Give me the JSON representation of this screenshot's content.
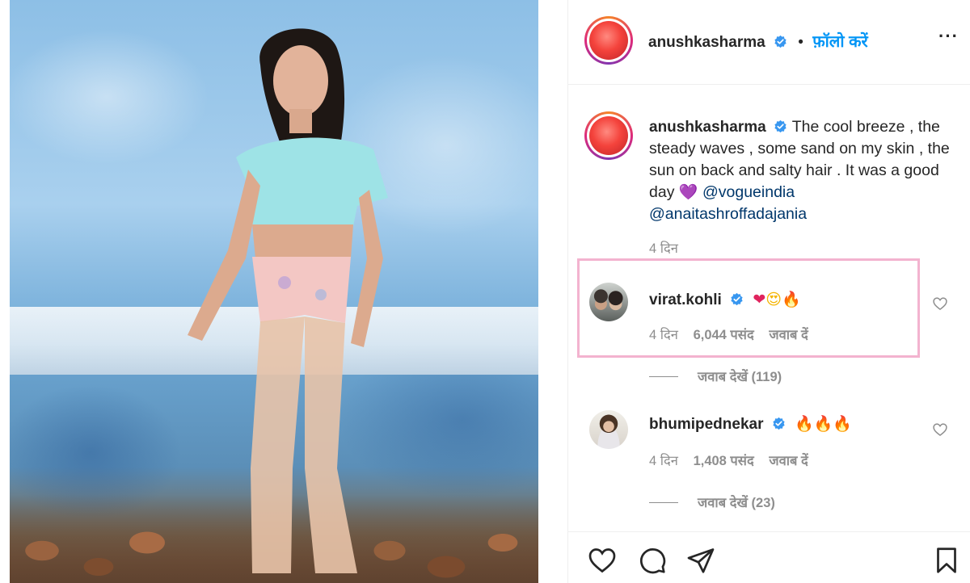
{
  "post": {
    "author": "anushkasharma",
    "follow_dot": "•",
    "follow_label": "फ़ॉलो करें",
    "more_label": "···"
  },
  "caption": {
    "author": "anushkasharma",
    "text": "The cool breeze , the steady waves , some sand on my skin , the sun on back and salty hair . It was a good day",
    "emoji": "💜",
    "mention_1": "@vogueindia",
    "mention_2": "@anaitashroffadajania",
    "time": "4 दिन"
  },
  "comments": [
    {
      "username": "virat.kohli",
      "emoji_1": "❤",
      "emoji_2": "😍",
      "emoji_3": "🔥",
      "time": "4 दिन",
      "likes": "6,044 पसंद",
      "reply": "जवाब दें",
      "view_replies": "जवाब देखें (119)"
    },
    {
      "username": "bhumipednekar",
      "emoji_1": "🔥",
      "emoji_2": "🔥",
      "emoji_3": "🔥",
      "time": "4 दिन",
      "likes": "1,408 पसंद",
      "reply": "जवाब दें",
      "view_replies": "जवाब देखें (23)"
    }
  ],
  "colors": {
    "link_blue": "#0095f6",
    "mention_blue": "#00376b",
    "verified_blue": "#3897f0",
    "highlight_pink": "#f3b3cf",
    "muted_text": "#8e8e8e"
  },
  "icons": [
    "heart-icon",
    "comment-icon",
    "share-icon",
    "bookmark-icon",
    "verified-icon",
    "more-options-icon"
  ]
}
